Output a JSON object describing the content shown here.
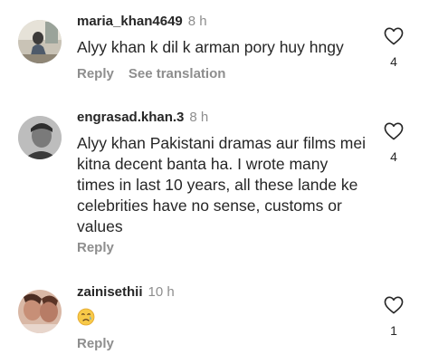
{
  "comments": [
    {
      "username": "maria_khan4649",
      "time": "8 h",
      "text": "Alyy khan k dil k arman pory huy hngy",
      "reply_label": "Reply",
      "translation_label": "See translation",
      "likes": "4",
      "avatar_icon": "user-avatar"
    },
    {
      "username": "engrasad.khan.3",
      "time": "8 h",
      "text": "Alyy khan Pakistani dramas aur films mei kitna decent banta ha. I wrote many times in last 10 years, all these lande ke celebrities have no sense, customs or values",
      "reply_label": "Reply",
      "likes": "4",
      "avatar_icon": "user-avatar"
    },
    {
      "username": "zainisethii",
      "time": "10 h",
      "emoji": "crying-face",
      "reply_label": "Reply",
      "likes": "1",
      "avatar_icon": "user-avatar"
    }
  ],
  "colors": {
    "text": "#262626",
    "muted": "#8e8e8e",
    "background": "#ffffff"
  }
}
